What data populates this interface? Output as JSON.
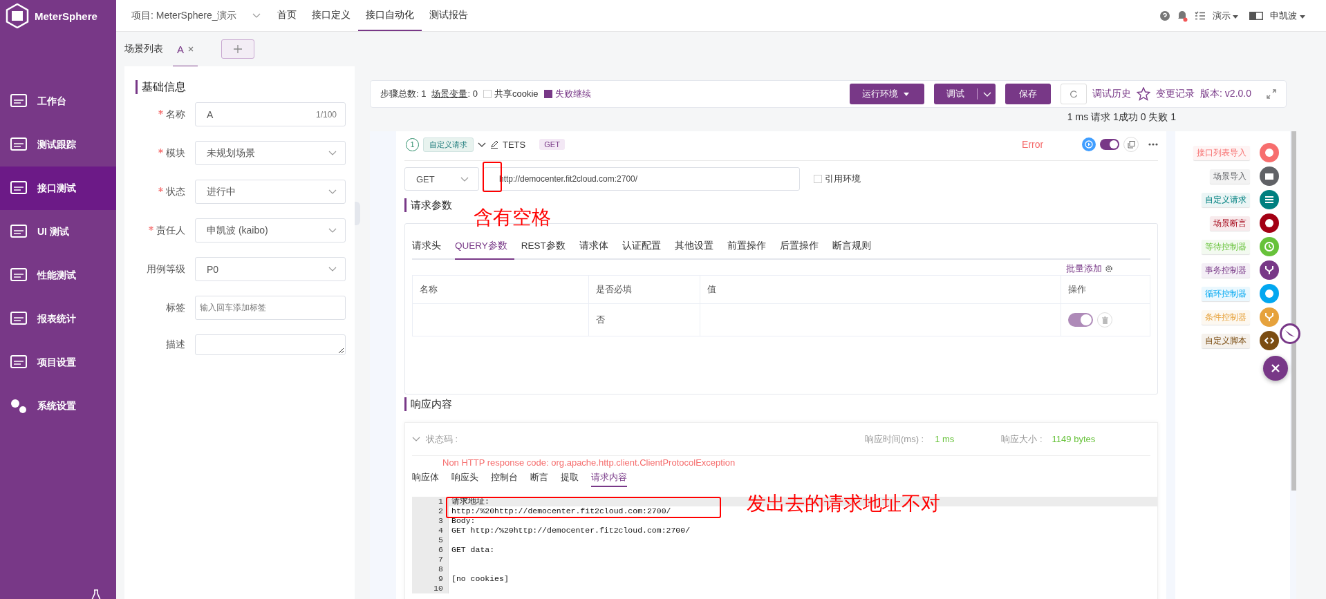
{
  "app": {
    "logo": "MeterSphere"
  },
  "sidebar": {
    "items": [
      {
        "label": "工作台",
        "selected": false
      },
      {
        "label": "测试跟踪",
        "selected": false
      },
      {
        "label": "接口测试",
        "selected": true
      },
      {
        "label": "UI 测试",
        "selected": false
      },
      {
        "label": "性能测试",
        "selected": false
      },
      {
        "label": "报表统计",
        "selected": false
      },
      {
        "label": "项目设置",
        "selected": false
      },
      {
        "label": "系统设置",
        "selected": false
      }
    ]
  },
  "header": {
    "project": "项目: MeterSphere_演示",
    "nav": [
      {
        "label": "首页",
        "selected": false
      },
      {
        "label": "接口定义",
        "selected": false
      },
      {
        "label": "接口自动化",
        "selected": true
      },
      {
        "label": "测试报告",
        "selected": false
      }
    ],
    "unread_notification": true,
    "workspace": "演示",
    "user": "申凯波"
  },
  "scenario_tabs": {
    "title": "场景列表",
    "tabs": [
      {
        "label": "A",
        "selected": true
      }
    ]
  },
  "basic_info": {
    "title": "基础信息",
    "fields": [
      {
        "kind": "text",
        "label": "名称",
        "required": true,
        "value": "A",
        "counter": "1/100"
      },
      {
        "kind": "select",
        "label": "模块",
        "required": true,
        "value": "未规划场景"
      },
      {
        "kind": "select",
        "label": "状态",
        "required": true,
        "value": "进行中"
      },
      {
        "kind": "select",
        "label": "责任人",
        "required": true,
        "value": "申凯波 (kaibo)"
      },
      {
        "kind": "select",
        "label": "用例等级",
        "required": false,
        "value": "P0"
      },
      {
        "kind": "tags",
        "label": "标签",
        "required": false,
        "placeholder": "输入回车添加标签"
      },
      {
        "kind": "textarea",
        "label": "描述",
        "required": false
      }
    ]
  },
  "toolbar": {
    "step_count_label": "步骤总数:",
    "step_count": "1",
    "variables_label": "场景变量",
    "variables": ": 0",
    "share_cookie": {
      "label": "共享cookie",
      "checked": false
    },
    "continue_on_fail": {
      "label": "失败继续",
      "checked": true
    },
    "env_button": "运行环境",
    "debug_button": "调试",
    "save_button": "保存",
    "history_link": "调试历史",
    "changes_link": "变更记录",
    "version": "版本: v2.0.0"
  },
  "summary": "1 ms 请求 1成功 0 失败 1",
  "step": {
    "index": "1",
    "type_tag": "自定义请求",
    "name": "TETS",
    "method_tag": "GET",
    "status": "Error",
    "enabled": true,
    "method": "GET",
    "url": "http://democenter.fit2cloud.com:2700/",
    "use_env": {
      "label": "引用环境",
      "checked": false
    },
    "params_title": "请求参数",
    "tabs": [
      {
        "label": "请求头",
        "selected": false
      },
      {
        "label": "QUERY参数",
        "selected": true
      },
      {
        "label": "REST参数",
        "selected": false
      },
      {
        "label": "请求体",
        "selected": false
      },
      {
        "label": "认证配置",
        "selected": false
      },
      {
        "label": "其他设置",
        "selected": false
      },
      {
        "label": "前置操作",
        "selected": false
      },
      {
        "label": "后置操作",
        "selected": false
      },
      {
        "label": "断言规则",
        "selected": false
      }
    ],
    "batch_add": "批量添加",
    "columns": [
      "名称",
      "是否必填",
      "值",
      "操作"
    ],
    "rows": [
      {
        "required": "否",
        "enabled": true
      }
    ]
  },
  "response": {
    "title": "响应内容",
    "status_label": "状态码 :",
    "time_label": "响应时间(ms) :",
    "time": "1 ms",
    "size_label": "响应大小 :",
    "size": "1149 bytes",
    "error": "Non HTTP response code: org.apache.http.client.ClientProtocolException",
    "tabs": [
      {
        "label": "响应体",
        "selected": false
      },
      {
        "label": "响应头",
        "selected": false
      },
      {
        "label": "控制台",
        "selected": false
      },
      {
        "label": "断言",
        "selected": false
      },
      {
        "label": "提取",
        "selected": false
      },
      {
        "label": "请求内容",
        "selected": true
      }
    ],
    "lines": [
      {
        "number": "1",
        "text": "请求地址:"
      },
      {
        "number": "2",
        "text": "http:/%20http://democenter.fit2cloud.com:2700/"
      },
      {
        "number": "3",
        "text": "Body:"
      },
      {
        "number": "4",
        "text": "GET http:/%20http://democenter.fit2cloud.com:2700/"
      },
      {
        "number": "5"
      },
      {
        "number": "6",
        "text": "GET data:"
      },
      {
        "number": "7"
      },
      {
        "number": "8"
      },
      {
        "number": "9",
        "text": "[no cookies]"
      },
      {
        "number": "10"
      }
    ]
  },
  "add_menu": [
    {
      "label": "接口列表导入",
      "color": "#f76e6e"
    },
    {
      "label": "场景导入",
      "color": "#606266"
    },
    {
      "label": "自定义请求",
      "color": "#008080"
    },
    {
      "label": "场景断言",
      "color": "#a30014"
    },
    {
      "label": "等待控制器",
      "color": "#67c23a"
    },
    {
      "label": "事务控制器",
      "color": "#783887"
    },
    {
      "label": "循环控制器",
      "color": "#02a7f0"
    },
    {
      "label": "条件控制器",
      "color": "#e6a23c"
    },
    {
      "label": "自定义脚本",
      "color": "#7b4d12"
    }
  ],
  "annotations": [
    {
      "text": "含有空格"
    },
    {
      "text": "发出去的请求地址不对"
    }
  ]
}
